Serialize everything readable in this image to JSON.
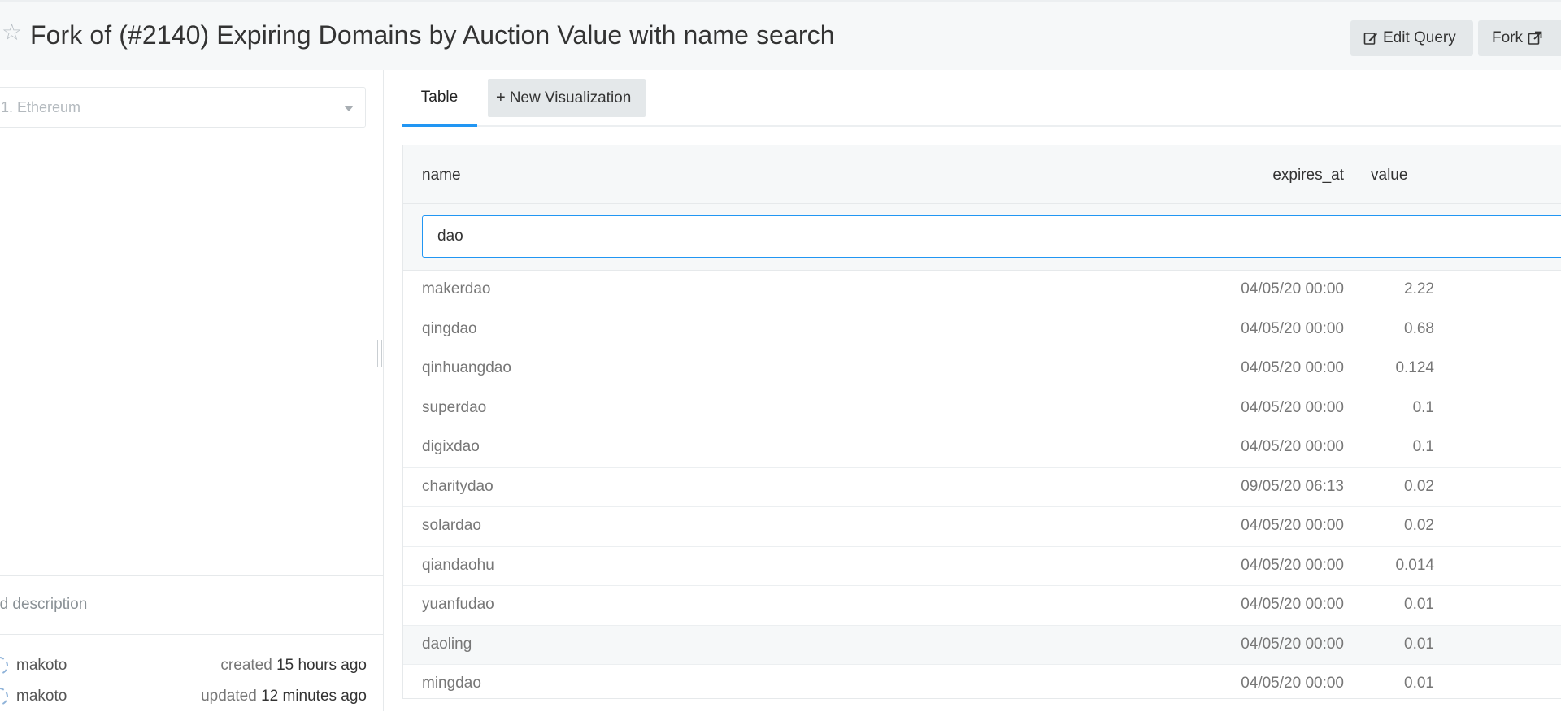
{
  "header": {
    "title": "Fork of (#2140) Expiring Domains by Auction Value with name search",
    "edit_label": "Edit Query",
    "fork_label": "Fork"
  },
  "sidebar": {
    "data_source": "1. Ethereum",
    "description_placeholder": "dd description",
    "meta": [
      {
        "user": "makoto",
        "action": "created",
        "when": "15 hours ago"
      },
      {
        "user": "makoto",
        "action": "updated",
        "when": "12 minutes ago"
      }
    ]
  },
  "tabs": {
    "table_label": "Table",
    "new_viz_label": "New Visualization"
  },
  "table": {
    "columns": [
      "name",
      "expires_at",
      "value"
    ],
    "filter_value": "dao",
    "rows": [
      {
        "name": "makerdao",
        "expires_at": "04/05/20 00:00",
        "value": "2.22"
      },
      {
        "name": "qingdao",
        "expires_at": "04/05/20 00:00",
        "value": "0.68"
      },
      {
        "name": "qinhuangdao",
        "expires_at": "04/05/20 00:00",
        "value": "0.124"
      },
      {
        "name": "superdao",
        "expires_at": "04/05/20 00:00",
        "value": "0.1"
      },
      {
        "name": "digixdao",
        "expires_at": "04/05/20 00:00",
        "value": "0.1"
      },
      {
        "name": "charitydao",
        "expires_at": "09/05/20 06:13",
        "value": "0.02"
      },
      {
        "name": "solardao",
        "expires_at": "04/05/20 00:00",
        "value": "0.02"
      },
      {
        "name": "qiandaohu",
        "expires_at": "04/05/20 00:00",
        "value": "0.014"
      },
      {
        "name": "yuanfudao",
        "expires_at": "04/05/20 00:00",
        "value": "0.01"
      },
      {
        "name": "daoling",
        "expires_at": "04/05/20 00:00",
        "value": "0.01"
      },
      {
        "name": "mingdao",
        "expires_at": "04/05/20 00:00",
        "value": "0.01"
      }
    ]
  },
  "icons": {
    "favorite": "star-icon",
    "edit": "edit-icon",
    "fork": "external-link-icon",
    "caret": "caret-down-icon"
  }
}
